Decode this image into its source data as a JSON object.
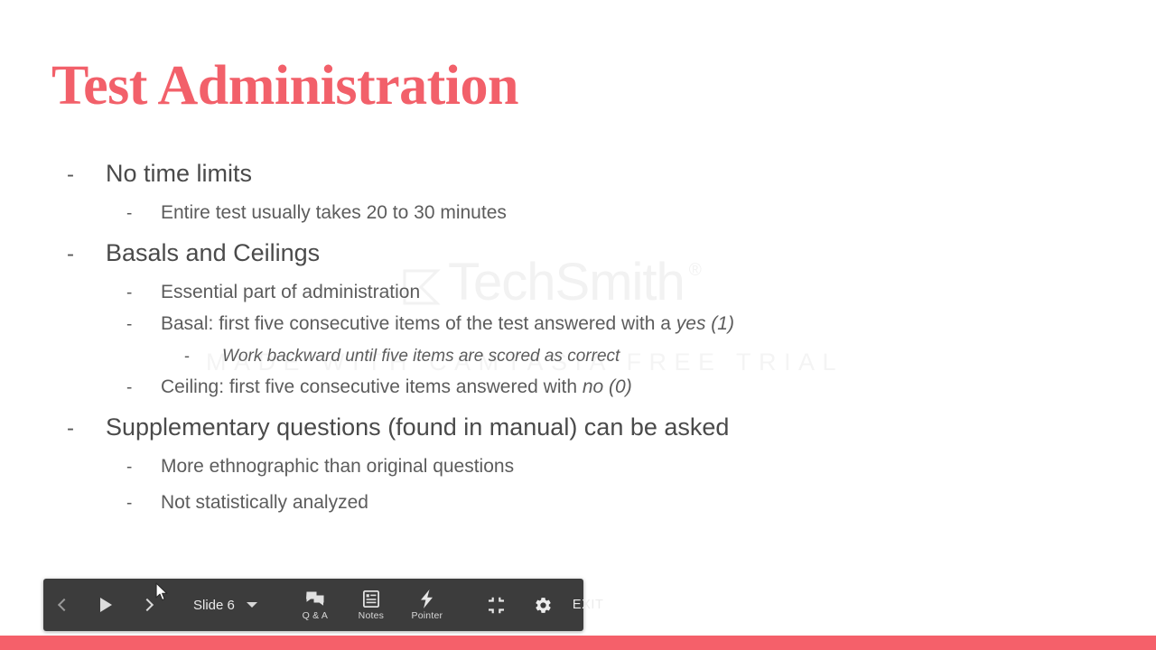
{
  "slide": {
    "title": "Test Administration",
    "background_color": "#ffffff",
    "title_color": "#f2606a",
    "accent_bar_color": "#f5606a",
    "bullets": [
      {
        "level": 1,
        "text": "No time limits"
      },
      {
        "level": 2,
        "text": "Entire test usually takes 20 to 30 minutes"
      },
      {
        "level": 1,
        "text": "Basals and Ceilings"
      },
      {
        "level": 2,
        "text": "Essential part of administration"
      },
      {
        "level": 2,
        "text": "Basal: first five consecutive items of the test answered with a ",
        "emphasis": "yes (1)"
      },
      {
        "level": 3,
        "text": "Work backward until five items are scored as correct"
      },
      {
        "level": 2,
        "text": "Ceiling:  first five consecutive items answered with ",
        "emphasis": "no (0)"
      },
      {
        "level": 1,
        "text": "Supplementary questions (found in manual) can be asked"
      },
      {
        "level": 2,
        "text": "More ethnographic than original questions"
      },
      {
        "level": 2,
        "text": "Not statistically analyzed"
      }
    ],
    "bullet_marker": "-"
  },
  "watermark": {
    "brand": "TechSmith",
    "registered_mark": "®",
    "tagline": "MADE WITH CAMTASIA FREE TRIAL",
    "color": "#f2f2f2"
  },
  "control_bar": {
    "background_color": "#3c3c3c",
    "previous_label": "Previous slide",
    "play_label": "Play",
    "next_label": "Next slide",
    "slide_indicator": "Slide 6",
    "tools": [
      {
        "name": "q-and-a",
        "label": "Q & A"
      },
      {
        "name": "notes",
        "label": "Notes"
      },
      {
        "name": "pointer",
        "label": "Pointer"
      }
    ],
    "exit_fullscreen_label": "Exit full screen",
    "settings_label": "Settings",
    "exit_label": "EXIT"
  }
}
